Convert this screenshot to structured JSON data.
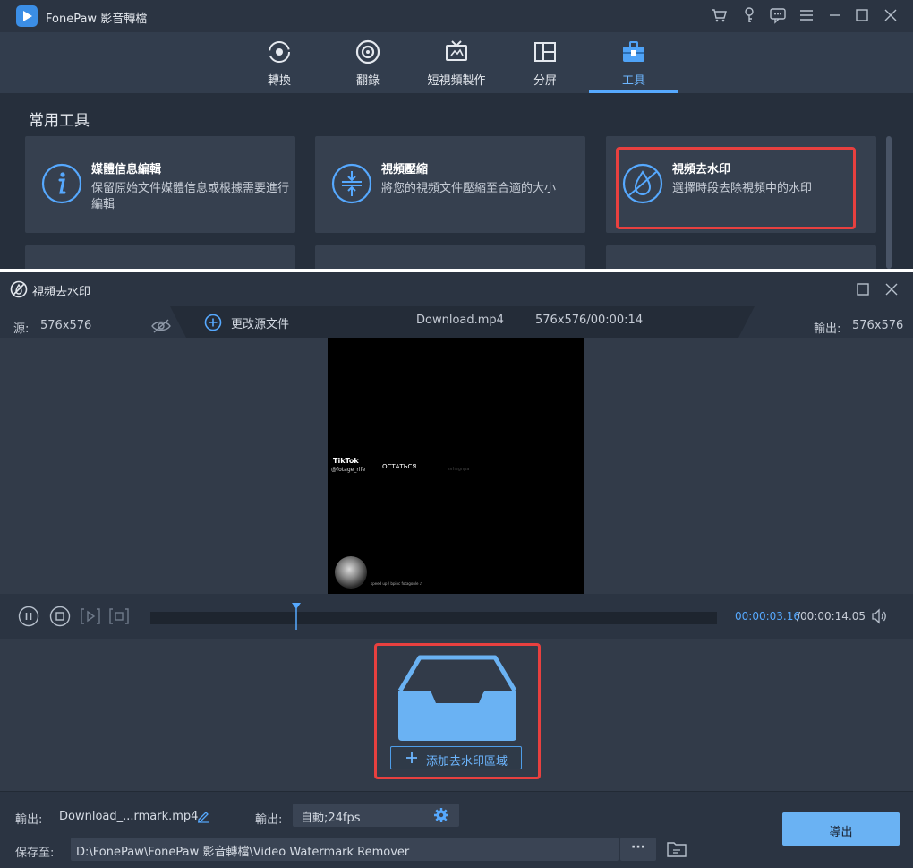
{
  "app": {
    "title": "FonePaw 影音轉檔",
    "title_icons": [
      "cart-icon",
      "key-icon",
      "chat-icon",
      "menu-icon",
      "minimize-icon",
      "maximize-icon",
      "close-icon"
    ]
  },
  "nav": {
    "tabs": [
      {
        "label": "轉換",
        "icon": "convert-icon"
      },
      {
        "label": "翻錄",
        "icon": "disc-icon"
      },
      {
        "label": "短視頻製作",
        "icon": "tv-icon"
      },
      {
        "label": "分屏",
        "icon": "split-screen-icon"
      },
      {
        "label": "工具",
        "icon": "toolbox-icon",
        "active": true
      }
    ]
  },
  "tools": {
    "section_title": "常用工具",
    "cards": [
      {
        "title": "媒體信息編輯",
        "desc": "保留原始文件媒體信息或根據需要進行編輯",
        "icon": "info-icon"
      },
      {
        "title": "視頻壓縮",
        "desc": "將您的視頻文件壓縮至合適的大小",
        "icon": "compress-icon"
      },
      {
        "title": "視頻去水印",
        "desc": "選擇時段去除視頻中的水印",
        "icon": "watermark-remove-icon",
        "highlighted": true
      }
    ]
  },
  "dialog": {
    "title": "視頻去水印",
    "source_label": "源:",
    "source_res": "576x576",
    "change_source": "更改源文件",
    "filename": "Download.mp4",
    "file_info": "576x576/00:00:14",
    "output_label": "輸出:",
    "output_res": "576x576",
    "video_overlay": {
      "brand": "TikTok",
      "handle": "@fotage_rlfe",
      "caption": "ОСТАТЬСЯ",
      "faint": "svhegnpa",
      "footer": "speed up / bpinc fotagonle ♪"
    },
    "player": {
      "current_time": "00:00:03.16",
      "total_time": "/00:00:14.05",
      "progress": 0.257
    },
    "add_area_label": "添加去水印區域",
    "bottom": {
      "output_label": "輸出:",
      "output_file": "Download_...rmark.mp4",
      "format_label": "輸出:",
      "format_value": "自動;24fps",
      "save_label": "保存至:",
      "save_path": "D:\\FonePaw\\FonePaw 影音轉檔\\Video Watermark Remover",
      "more_label": "···",
      "export_label": "導出"
    }
  },
  "colors": {
    "accent": "#56a9ff",
    "highlight": "#e8403f",
    "export_button": "#6ab2f3"
  }
}
